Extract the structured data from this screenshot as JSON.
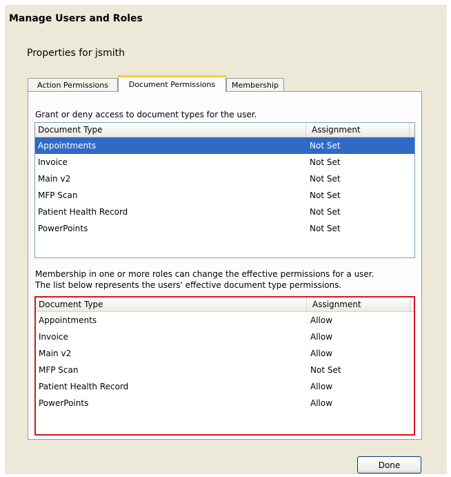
{
  "window": {
    "title": "Manage Users and Roles"
  },
  "properties_title": "Properties for jsmith",
  "tabs": [
    {
      "label": "Action Permissions",
      "active": false
    },
    {
      "label": "Document Permissions",
      "active": true
    },
    {
      "label": "Membership",
      "active": false
    }
  ],
  "user_permissions": {
    "description": "Grant or deny access to document types for the user.",
    "columns": [
      "Document Type",
      "Assignment"
    ],
    "rows": [
      {
        "type": "Appointments",
        "assignment": "Not Set",
        "selected": true
      },
      {
        "type": "Invoice",
        "assignment": "Not Set"
      },
      {
        "type": "Main v2",
        "assignment": "Not Set"
      },
      {
        "type": "MFP Scan",
        "assignment": "Not Set"
      },
      {
        "type": "Patient Health Record",
        "assignment": "Not Set"
      },
      {
        "type": "PowerPoints",
        "assignment": "Not Set"
      }
    ]
  },
  "effective_permissions": {
    "description_line1": "Membership in one or more roles can change the effective permissions for a user.",
    "description_line2": "The list below represents the users' effective document type permissions.",
    "columns": [
      "Document Type",
      "Assignment"
    ],
    "rows": [
      {
        "type": "Appointments",
        "assignment": "Allow"
      },
      {
        "type": "Invoice",
        "assignment": "Allow"
      },
      {
        "type": "Main v2",
        "assignment": "Allow"
      },
      {
        "type": "MFP Scan",
        "assignment": "Not Set"
      },
      {
        "type": "Patient Health Record",
        "assignment": "Allow"
      },
      {
        "type": "PowerPoints",
        "assignment": "Allow"
      }
    ]
  },
  "buttons": {
    "done": "Done"
  },
  "colors": {
    "background": "#ECE9D8",
    "selection": "#316AC5",
    "highlight_border": "#D7101A",
    "active_tab_accent": "#FFC83C"
  }
}
